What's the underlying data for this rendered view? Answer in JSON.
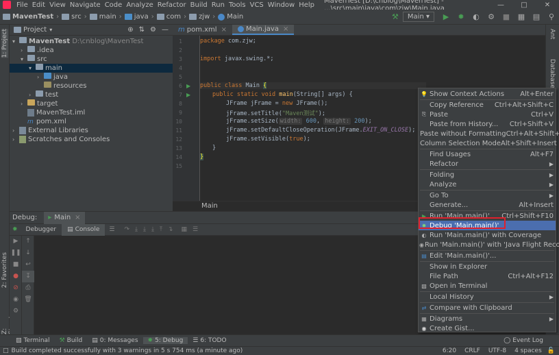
{
  "menubar": {
    "items": [
      "File",
      "Edit",
      "View",
      "Navigate",
      "Code",
      "Analyze",
      "Refactor",
      "Build",
      "Run",
      "Tools",
      "VCS",
      "Window",
      "Help"
    ],
    "title": "MavenTest [D:\\cnblog\\MavenTest] - ...\\src\\main\\java\\com\\zjw\\Main.java"
  },
  "navbar": {
    "crumbs": [
      "MavenTest",
      "src",
      "main",
      "java",
      "com",
      "zjw",
      "Main"
    ],
    "run_config": "Main"
  },
  "left_stripe": {
    "project": "1: Project",
    "favorites": "2: Favorites",
    "structure": "Z: Structure"
  },
  "right_stripe": {
    "ant": "Ant",
    "database": "Database"
  },
  "project": {
    "title": "Project",
    "rows": [
      {
        "label": "MavenTest",
        "note": "D:\\cnblog\\MavenTest"
      },
      {
        "label": ".idea"
      },
      {
        "label": "src"
      },
      {
        "label": "main"
      },
      {
        "label": "java"
      },
      {
        "label": "resources"
      },
      {
        "label": "test"
      },
      {
        "label": "target"
      },
      {
        "label": "MavenTest.iml"
      },
      {
        "label": "pom.xml"
      },
      {
        "label": "External Libraries"
      },
      {
        "label": "Scratches and Consoles"
      }
    ]
  },
  "editor": {
    "tabs": [
      "pom.xml",
      "Main.java"
    ],
    "line_numbers": [
      "1",
      "2",
      "3",
      "4",
      "5",
      "6",
      "7",
      "8",
      "9",
      "10",
      "11",
      "12",
      "13",
      "14",
      "15"
    ],
    "code": {
      "l1": [
        "package",
        " com.zjw;"
      ],
      "l3": [
        "import",
        " javax.swing.*;"
      ],
      "l6": [
        "public class",
        " Main ",
        "{"
      ],
      "l7": [
        "public static void ",
        "main",
        "(String[] args) {"
      ],
      "l8": [
        "JFrame jFrame = ",
        "new",
        " JFrame();"
      ],
      "l9": [
        "jFrame.setTitle(",
        "\"Maven测试\"",
        ");"
      ],
      "l10": [
        "jFrame.setSize(",
        "width:",
        "600",
        ", ",
        "height:",
        "200",
        ");"
      ],
      "l11": [
        "jFrame.setDefaultCloseOperation(JFrame.",
        "EXIT_ON_CLOSE",
        ");"
      ],
      "l12": [
        "jFrame.setVisible(",
        "true",
        ");"
      ],
      "l13": "}",
      "l14": "}"
    },
    "breadcrumb": "Main"
  },
  "debug": {
    "label": "Debug:",
    "session": "Main",
    "tabs": [
      "Debugger",
      "Console"
    ]
  },
  "context_menu": [
    {
      "label": "Show Context Actions",
      "shortcut": "Alt+Enter",
      "icon": "bulb"
    },
    {
      "label": "Copy Reference",
      "shortcut": "Ctrl+Alt+Shift+C"
    },
    {
      "label": "Paste",
      "shortcut": "Ctrl+V",
      "icon": "paste"
    },
    {
      "label": "Paste from History...",
      "shortcut": "Ctrl+Shift+V"
    },
    {
      "label": "Paste without Formatting",
      "shortcut": "Ctrl+Alt+Shift+V"
    },
    {
      "label": "Column Selection Mode",
      "shortcut": "Alt+Shift+Insert"
    },
    {
      "label": "Find Usages",
      "shortcut": "Alt+F7"
    },
    {
      "label": "Refactor",
      "submenu": true
    },
    {
      "label": "Folding",
      "submenu": true
    },
    {
      "label": "Analyze",
      "submenu": true
    },
    {
      "label": "Go To",
      "submenu": true
    },
    {
      "label": "Generate...",
      "shortcut": "Alt+Insert"
    },
    {
      "label": "Run 'Main.main()'",
      "shortcut": "Ctrl+Shift+F10",
      "icon": "run"
    },
    {
      "label": "Debug 'Main.main()'",
      "highlighted": true,
      "icon": "debug"
    },
    {
      "label": "Run 'Main.main()' with Coverage",
      "icon": "coverage"
    },
    {
      "label": "Run 'Main.main()' with 'Java Flight Recorder'",
      "icon": "jfr"
    },
    {
      "label": "Edit 'Main.main()'...",
      "icon": "edit"
    },
    {
      "label": "Show in Explorer"
    },
    {
      "label": "File Path",
      "shortcut": "Ctrl+Alt+F12"
    },
    {
      "label": "Open in Terminal",
      "icon": "terminal"
    },
    {
      "label": "Local History",
      "submenu": true
    },
    {
      "label": "Compare with Clipboard",
      "icon": "compare"
    },
    {
      "label": "Diagrams",
      "submenu": true,
      "icon": "diagram"
    },
    {
      "label": "Create Gist...",
      "icon": "github"
    }
  ],
  "toolwindows": [
    "Terminal",
    "Build",
    "0: Messages",
    "5: Debug",
    "6: TODO"
  ],
  "event_log": "Event Log",
  "status": {
    "message": "Build completed successfully with 3 warnings in 5 s 754 ms (a minute ago)",
    "position": "6:20",
    "line_sep": "CRLF",
    "encoding": "UTF-8",
    "indent": "4 spaces"
  },
  "colors": {
    "accent": "#4b6eaf",
    "highlight_box": "#e0202c",
    "run_green": "#499c54"
  }
}
